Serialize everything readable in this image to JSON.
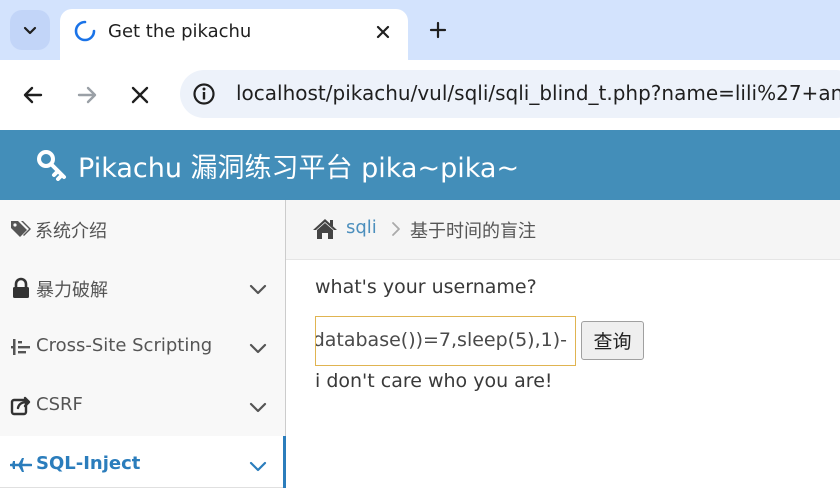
{
  "browser": {
    "tab_title": "Get the pikachu",
    "url": "localhost/pikachu/vul/sqli/sqli_blind_t.php?name=lili%27+and"
  },
  "header": {
    "brand": "Pikachu 漏洞练习平台 pika~pika~"
  },
  "sidebar": {
    "items": [
      {
        "label": "系统介绍",
        "icon": "tags-icon"
      },
      {
        "label": "暴力破解",
        "icon": "lock-icon"
      },
      {
        "label": "Cross-Site Scripting",
        "icon": "indent-icon"
      },
      {
        "label": "CSRF",
        "icon": "share-icon"
      },
      {
        "label": "SQL-Inject",
        "icon": "plane-icon"
      }
    ]
  },
  "breadcrumb": {
    "link": "sqli",
    "current": "基于时间的盲注"
  },
  "main": {
    "question": "what's your username?",
    "input_value": "database())=7,sleep(5),1)-",
    "button_label": "查询",
    "result": "i don't care who you are!"
  },
  "colors": {
    "header_bg": "#438eb9",
    "active_link": "#2b7dbc",
    "input_border": "#e0b451"
  }
}
